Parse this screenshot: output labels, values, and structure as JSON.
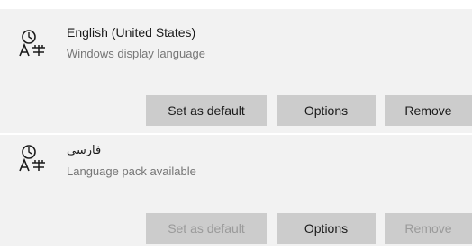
{
  "languages": [
    {
      "icon": "language-icon",
      "name": "English (United States)",
      "subtitle": "Windows display language",
      "buttons": {
        "set_default": "Set as default",
        "options": "Options",
        "remove": "Remove"
      }
    },
    {
      "icon": "language-icon",
      "name": "فارسی",
      "subtitle": "Language pack available",
      "buttons": {
        "set_default": "Set as default",
        "options": "Options",
        "remove": "Remove"
      },
      "disabled": [
        "set_default",
        "remove"
      ]
    }
  ],
  "colors": {
    "item_background": "#f2f2f2",
    "button_background": "#cccccc",
    "disabled_text": "#9a9a9a",
    "secondary_text": "#767676"
  }
}
